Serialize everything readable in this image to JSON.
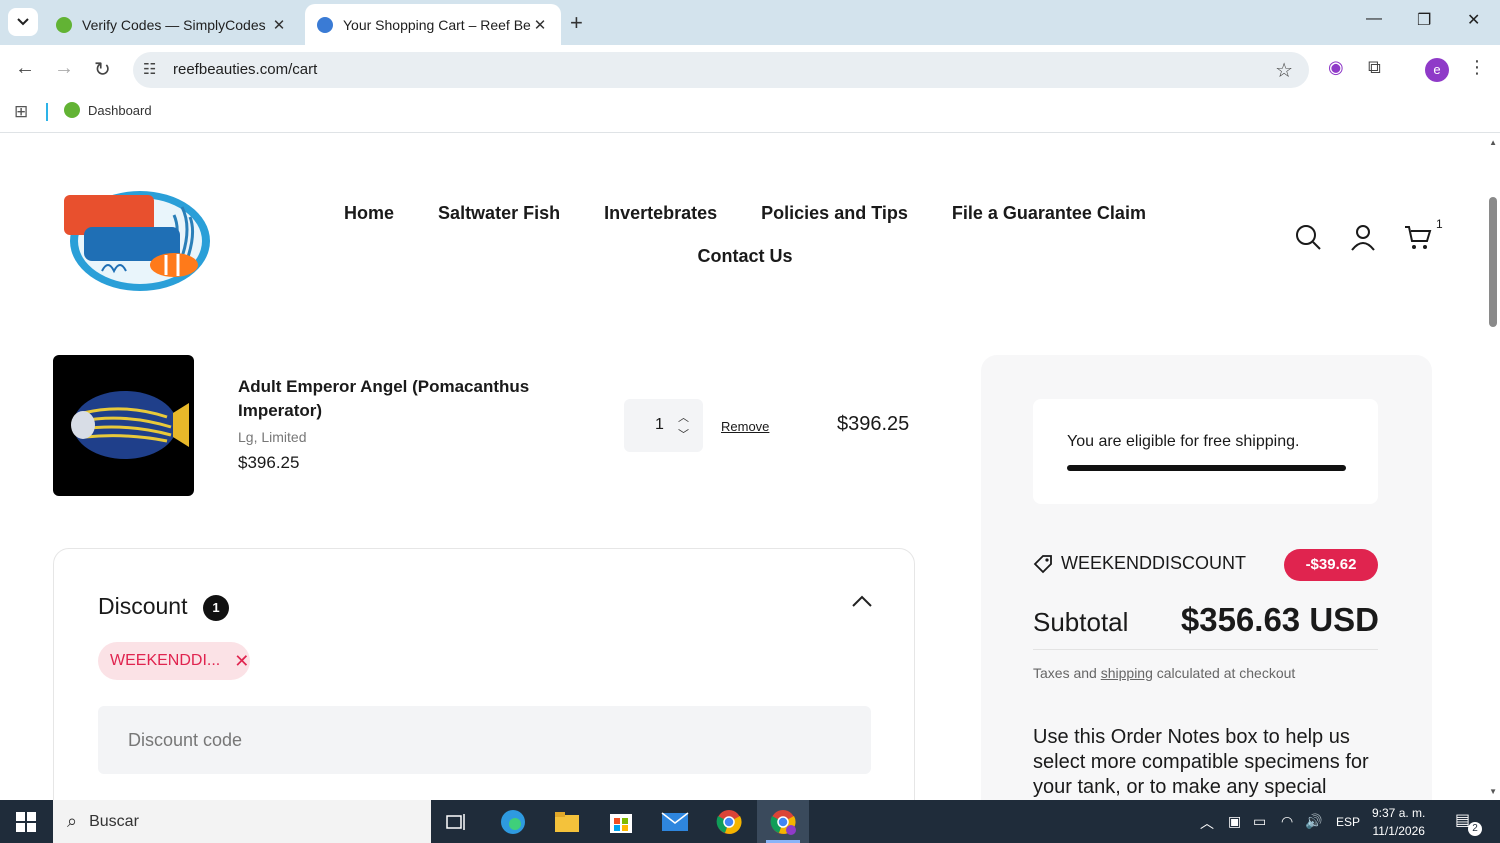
{
  "browser": {
    "tabs": [
      {
        "title": "Verify Codes — SimplyCodes",
        "active": false,
        "favicon_color": "#62b334"
      },
      {
        "title": "Your Shopping Cart – Reef Beau",
        "active": true,
        "favicon_color": "#3a7bd5"
      }
    ],
    "url": "reefbeauties.com/cart",
    "profile_initial": "e",
    "bookmarks": [
      {
        "label": "Dashboard"
      }
    ]
  },
  "site": {
    "nav": {
      "row1": [
        "Home",
        "Saltwater Fish",
        "Invertebrates",
        "Policies and Tips",
        "File a Guarantee Claim"
      ],
      "row2": [
        "Contact Us"
      ]
    },
    "cart_count": "1"
  },
  "cart": {
    "item": {
      "name": "Adult Emperor Angel (Pomacanthus Imperator)",
      "variant": "Lg, Limited",
      "price": "$396.25",
      "quantity": "1",
      "remove_label": "Remove",
      "line_total": "$396.25"
    },
    "discount": {
      "title": "Discount",
      "count": "1",
      "applied_chip": "WEEKENDDI...",
      "placeholder": "Discount code"
    }
  },
  "summary": {
    "shipping_message": "You are eligible for free shipping.",
    "shipping_progress": 1.0,
    "code_name": "WEEKENDDISCOUNT",
    "code_amount": "-$39.62",
    "subtotal_label": "Subtotal",
    "subtotal_value": "$356.63 USD",
    "tax_pre": "Taxes and ",
    "tax_link": "shipping",
    "tax_post": " calculated at checkout",
    "notes_text": "Use this Order Notes box to help us select more compatible specimens for your tank, or to make any special"
  },
  "taskbar": {
    "search_placeholder": "Buscar",
    "language": "ESP",
    "time": "9:37 a. m.",
    "date": "11/1/2026",
    "notification_count": "2"
  },
  "colors": {
    "accent_pink": "#e0244f",
    "chip_bg": "#fbe2e6",
    "chrome_tabbar": "#d3e3ed",
    "taskbar": "#1f2c3a"
  }
}
